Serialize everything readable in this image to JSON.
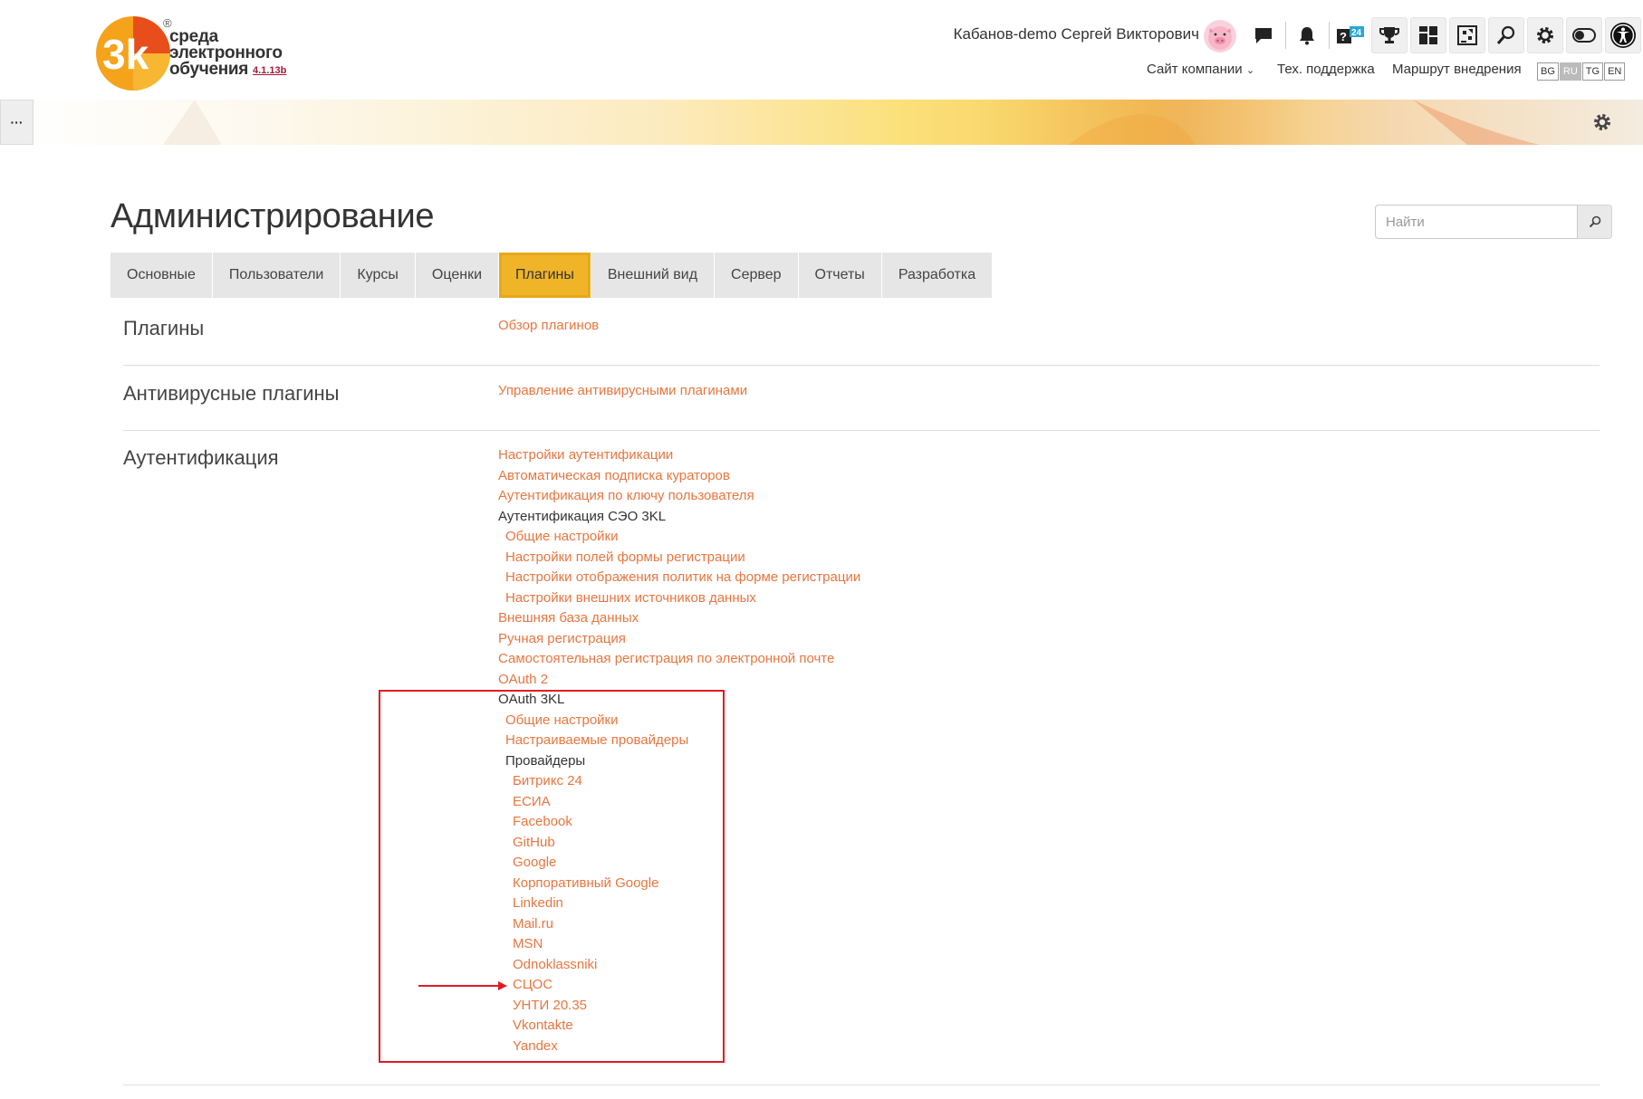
{
  "header": {
    "logo": {
      "line1": "среда",
      "line2": "электронного",
      "line3": "обучения",
      "version": "4.1.13b",
      "registered": "®",
      "brand_colors": [
        "#f5a31a",
        "#e84e1b",
        "#a01c3a"
      ]
    },
    "user_name": "Кабанов-demo Сергей Викторович",
    "icons": [
      "chat-icon",
      "bell-icon",
      "help-icon",
      "trophy-icon",
      "dashboard-icon",
      "chess-icon",
      "search-icon",
      "gear-icon",
      "toggle-icon",
      "accessibility-icon"
    ],
    "top_links": {
      "company_site": "Сайт компании",
      "support": "Тех. поддержка",
      "roadmap": "Маршрут внедрения"
    },
    "languages": [
      "BG",
      "RU",
      "TG",
      "EN"
    ],
    "active_language": "RU"
  },
  "drawer_button": "···",
  "page": {
    "title": "Администрирование",
    "search_placeholder": "Найти"
  },
  "tabs": [
    {
      "label": "Основные"
    },
    {
      "label": "Пользователи"
    },
    {
      "label": "Курсы"
    },
    {
      "label": "Оценки"
    },
    {
      "label": "Плагины",
      "active": true
    },
    {
      "label": "Внешний вид"
    },
    {
      "label": "Сервер"
    },
    {
      "label": "Отчеты"
    },
    {
      "label": "Разработка"
    }
  ],
  "sections": {
    "plugins": {
      "title": "Плагины",
      "links": [
        "Обзор плагинов"
      ]
    },
    "antivirus": {
      "title": "Антивирусные плагины",
      "links": [
        "Управление антивирусными плагинами"
      ]
    },
    "auth": {
      "title": "Аутентификация",
      "items": [
        {
          "text": "Настройки аутентификации",
          "link": true,
          "level": 0
        },
        {
          "text": "Автоматическая подписка кураторов",
          "link": true,
          "level": 0
        },
        {
          "text": "Аутентификация по ключу пользователя",
          "link": true,
          "level": 0
        },
        {
          "text": "Аутентификация СЭО 3KL",
          "link": false,
          "level": 0
        },
        {
          "text": "Общие настройки",
          "link": true,
          "level": 1
        },
        {
          "text": "Настройки полей формы регистрации",
          "link": true,
          "level": 1
        },
        {
          "text": "Настройки отображения политик на форме регистрации",
          "link": true,
          "level": 1
        },
        {
          "text": "Настройки внешних источников данных",
          "link": true,
          "level": 1
        },
        {
          "text": "Внешняя база данных",
          "link": true,
          "level": 0
        },
        {
          "text": "Ручная регистрация",
          "link": true,
          "level": 0
        },
        {
          "text": "Самостоятельная регистрация по электронной почте",
          "link": true,
          "level": 0
        },
        {
          "text": "OAuth 2",
          "link": true,
          "level": 0
        },
        {
          "text": "OAuth 3KL",
          "link": false,
          "level": 0
        },
        {
          "text": "Общие настройки",
          "link": true,
          "level": 1
        },
        {
          "text": "Настраиваемые провайдеры",
          "link": true,
          "level": 1
        },
        {
          "text": "Провайдеры",
          "link": false,
          "level": 1
        },
        {
          "text": "Битрикс 24",
          "link": true,
          "level": 2
        },
        {
          "text": "ЕСИА",
          "link": true,
          "level": 2
        },
        {
          "text": "Facebook",
          "link": true,
          "level": 2
        },
        {
          "text": "GitHub",
          "link": true,
          "level": 2
        },
        {
          "text": "Google",
          "link": true,
          "level": 2
        },
        {
          "text": "Корпоративный Google",
          "link": true,
          "level": 2
        },
        {
          "text": "Linkedin",
          "link": true,
          "level": 2
        },
        {
          "text": "Mail.ru",
          "link": true,
          "level": 2
        },
        {
          "text": "MSN",
          "link": true,
          "level": 2
        },
        {
          "text": "Odnoklassniki",
          "link": true,
          "level": 2
        },
        {
          "text": "СЦОС",
          "link": true,
          "level": 2
        },
        {
          "text": "УНТИ 20.35",
          "link": true,
          "level": 2
        },
        {
          "text": "Vkontakte",
          "link": true,
          "level": 2
        },
        {
          "text": "Yandex",
          "link": true,
          "level": 2
        }
      ]
    }
  },
  "colors": {
    "link": "#e8763f",
    "active_tab": "#f0b429",
    "annotation": "#e01b22"
  }
}
